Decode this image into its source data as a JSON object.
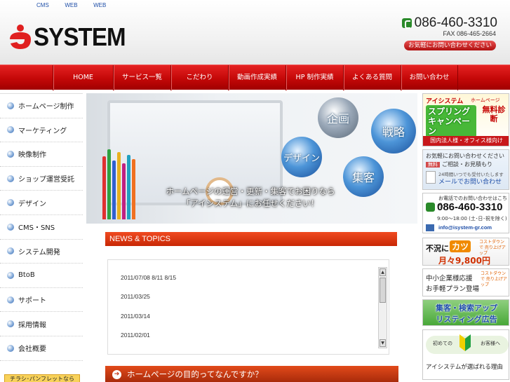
{
  "header": {
    "top_links": [
      "CMS",
      "WEB",
      "WEB"
    ],
    "logo_text": "SYSTEM",
    "phone": "086-460-3310",
    "fax": "FAX 086-465-2664",
    "contact_button": "お気軽にお問い合わせください"
  },
  "nav": {
    "items": [
      "HOME",
      "サービス一覧",
      "こだわり",
      "動画作成実績",
      "HP 制作実績",
      "よくある質問",
      "お問い合わせ"
    ]
  },
  "sidebar": {
    "items": [
      "ホームページ制作",
      "マーケティング",
      "映像制作",
      "ショップ運営受託",
      "デザイン",
      "CMS・SNS",
      "システム開発",
      "BtoB",
      "サポート",
      "採用情報",
      "会社概要"
    ],
    "bottom_banner": "チラシ･パンフレットなら"
  },
  "hero": {
    "bubbles": [
      "企画",
      "戦略",
      "デザイン",
      "集客"
    ],
    "caption_line1": "ホームページの運営・更新・集客でお困りなら",
    "caption_line2": "「アイシステム」にお任せください！"
  },
  "news": {
    "title": "NEWS & TOPICS",
    "items": [
      "2011/07/08  8/11 8/15",
      "2011/03/25",
      "2011/03/14",
      "2011/02/01"
    ]
  },
  "purpose": {
    "text": "ホームページの目的ってなんですか？"
  },
  "right": {
    "campaign": {
      "title": "アイシステム",
      "tag": "ホームページ",
      "headline": "スプリングキャンペーン",
      "badge": "無料診断",
      "footer": "国内法人様・オフィス様向け"
    },
    "contact": {
      "line1": "お気軽にお問い合わせください",
      "free_tag": "無料",
      "line2": "ご相談・お見積もり",
      "line3": "24時間いつでも受付いたします",
      "line4": "メールでお問い合わせ"
    },
    "phone_box": {
      "line1": "お電話でのお問い合わせはこちら",
      "phone": "086-460-3310",
      "hours": "9:00～18:00 (土･日･祝を除く)",
      "email": "info@isystem-gr.com"
    },
    "katsu": {
      "prefix": "不況に",
      "badge": "カツ",
      "small": "コストダウンで 売り上げアップ",
      "price": "月々9,800円"
    },
    "sme": {
      "line1": "中小企業様応援",
      "line2": "お手軽プラン登場",
      "small": "コストダウンで 売り上げアップ"
    },
    "listing": {
      "line1": "集客・検索アップ",
      "line2": "リスティング広告"
    },
    "beginner": {
      "left": "初めての",
      "right": "お客様へ",
      "bottom": "アイシステムが選ばれる理由"
    }
  }
}
